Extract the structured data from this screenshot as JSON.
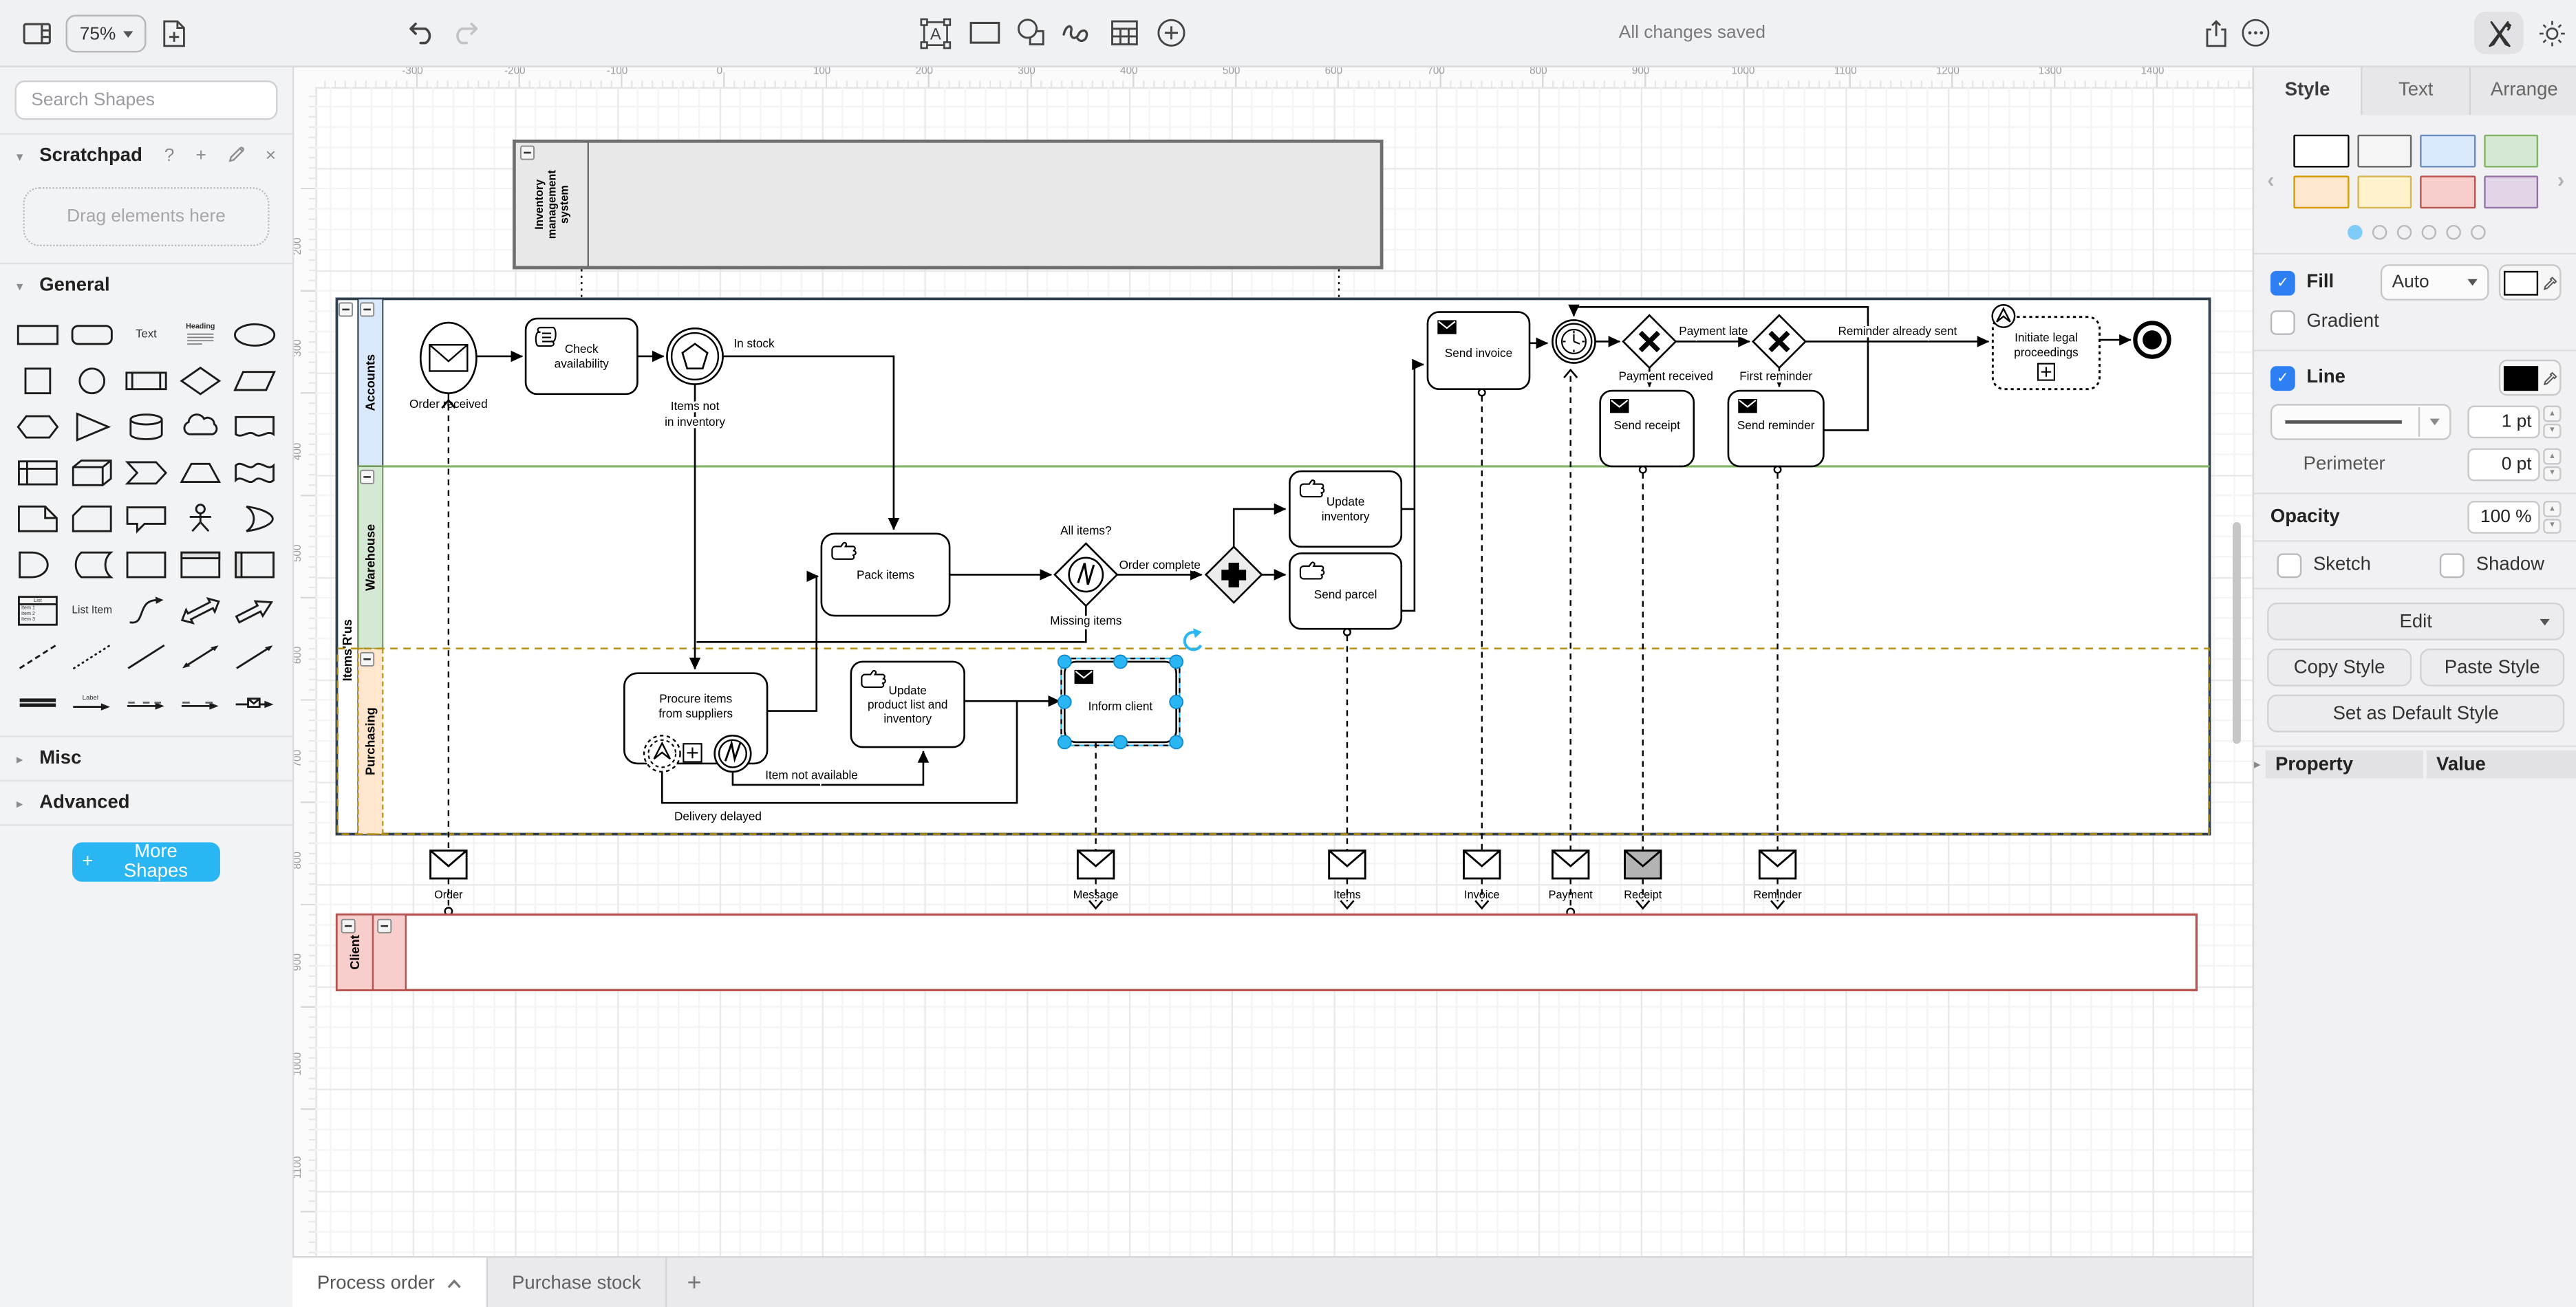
{
  "toolbar": {
    "zoom_level": "75%",
    "status": "All changes saved"
  },
  "sidebar": {
    "search_placeholder": "Search Shapes",
    "scratchpad_title": "Scratchpad",
    "scratchpad_hint": "Drag elements here",
    "scratchpad_icons": [
      "?",
      "+"
    ],
    "sections": {
      "general": "General",
      "misc": "Misc",
      "advanced": "Advanced"
    },
    "more_shapes_label": "More Shapes",
    "palette_labels": {
      "text": "Text",
      "heading": "Heading",
      "list": "List",
      "list_items": [
        "Item 1",
        "Item 2",
        "Item 3"
      ],
      "list_item": "List Item",
      "edge_label": "Label"
    },
    "shapes": [
      "rectangle",
      "rounded-rectangle",
      "text",
      "heading",
      "ellipse",
      "square",
      "circle",
      "process",
      "diamond",
      "parallelogram",
      "hexagon",
      "triangle",
      "cylinder",
      "cloud",
      "document",
      "internal-storage",
      "cube",
      "step",
      "trapezoid",
      "tape",
      "note",
      "card",
      "callout",
      "actor",
      "or",
      "and",
      "data-storage",
      "container",
      "vertical-container",
      "horizontal-container",
      "list",
      "list-item",
      "curve",
      "bidirectional-arrow",
      "arrow",
      "dashed-line",
      "dotted-line",
      "line",
      "bidirectional-connector",
      "directional-connector",
      "link",
      "connector-with-label",
      "connector-3-labels",
      "connector-2-labels",
      "connector-with-symbol"
    ]
  },
  "canvas": {
    "ruler_top": [
      -300,
      -200,
      -100,
      0,
      100,
      200,
      300,
      400,
      500,
      600,
      700,
      800,
      900,
      1000,
      1100,
      1200,
      1300,
      1400
    ],
    "ruler_left": [
      200,
      300,
      400,
      500,
      600,
      700,
      800,
      900,
      1000,
      1100
    ]
  },
  "diagram": {
    "pool_system": "Inventory\nmanagement\nsystem",
    "lane_accounts": "Accounts",
    "pool_items": "Items'R'us",
    "lane_warehouse": "Warehouse",
    "lane_purchasing": "Purchasing",
    "pool_client": "Client",
    "start_event": "Order received",
    "task_check": "Check\navailability",
    "flow_in_stock": "In stock",
    "flow_items_not": "Items not\nin inventory",
    "task_pack": "Pack items",
    "gw_all_items": "All items?",
    "flow_order_complete": "Order complete",
    "flow_missing": "Missing items",
    "task_update_inventory": "Update\ninventory",
    "task_send_parcel": "Send parcel",
    "task_procure": "Procure items\nfrom suppliers",
    "task_update_product": "Update\nproduct list and\ninventory",
    "task_inform": "Inform client",
    "flow_item_na": "Item not available",
    "flow_delivery": "Delivery delayed",
    "task_send_invoice": "Send invoice",
    "flow_payment_received": "Payment received",
    "flow_payment_late": "Payment late",
    "flow_first_reminder": "First reminder",
    "task_send_receipt": "Send receipt",
    "task_send_reminder": "Send reminder",
    "flow_reminder_sent": "Reminder already sent",
    "task_legal": "Initiate legal\nproceedings",
    "msg_order": "Order",
    "msg_message": "Message",
    "msg_items": "Items",
    "msg_invoice": "Invoice",
    "msg_payment": "Payment",
    "msg_receipt": "Receipt",
    "msg_reminder": "Reminder"
  },
  "right_panel": {
    "tabs": [
      "Style",
      "Text",
      "Arrange"
    ],
    "active_tab": "Style",
    "presets": [
      {
        "fill": "#ffffff",
        "stroke": "#000000"
      },
      {
        "fill": "#f5f5f5",
        "stroke": "#666666"
      },
      {
        "fill": "#dae8fc",
        "stroke": "#6c8ebf"
      },
      {
        "fill": "#d5e8d4",
        "stroke": "#82b366"
      },
      {
        "fill": "#ffe6cc",
        "stroke": "#d79b00"
      },
      {
        "fill": "#fff2cc",
        "stroke": "#d6b656"
      },
      {
        "fill": "#f8cecc",
        "stroke": "#b85450"
      },
      {
        "fill": "#e1d5e7",
        "stroke": "#9673a6"
      }
    ],
    "page_dots": 6,
    "active_dot": 0,
    "fill_label": "Fill",
    "fill_mode": "Auto",
    "gradient_label": "Gradient",
    "line_label": "Line",
    "line_width": "1 pt",
    "perimeter_label": "Perimeter",
    "perimeter_value": "0 pt",
    "opacity_label": "Opacity",
    "opacity_value": "100 %",
    "sketch_label": "Sketch",
    "shadow_label": "Shadow",
    "edit_label": "Edit",
    "copy_style": "Copy Style",
    "paste_style": "Paste Style",
    "default_style": "Set as Default Style",
    "property_header": "Property",
    "value_header": "Value"
  },
  "bottom_bar": {
    "tabs": [
      "Process order",
      "Purchase stock"
    ],
    "active_tab": "Process order"
  },
  "colors": {
    "accent_blue": "#29b6f2",
    "lane_accounts_fill": "#dae8fc",
    "lane_warehouse_fill": "#d5e8d4",
    "lane_purchasing_fill": "#ffe6cc",
    "client_fill": "#f8cecc",
    "client_stroke": "#b85450",
    "selection_gold": "#b5910f"
  }
}
